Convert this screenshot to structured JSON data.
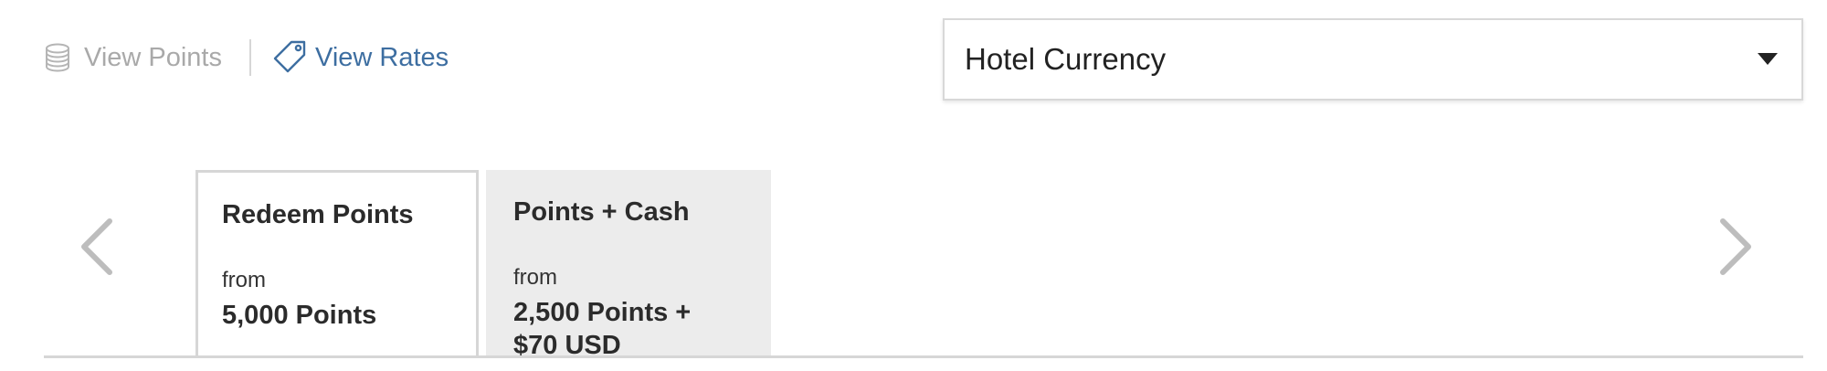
{
  "toggle": {
    "points_label": "View Points",
    "rates_label": "View Rates"
  },
  "currency": {
    "selected": "Hotel Currency"
  },
  "rate_tabs": [
    {
      "title": "Redeem Points",
      "from_label": "from",
      "price": "5,000 Points",
      "selected": true
    },
    {
      "title": "Points + Cash",
      "from_label": "from",
      "price": "2,500 Points + $70 USD",
      "selected": false
    }
  ],
  "colors": {
    "link_active": "#3d6ea1",
    "link_inactive": "#a9a9a9",
    "tab_inactive_bg": "#ececec",
    "border": "#d6d6d6"
  },
  "icons": [
    "coins-stack-icon",
    "price-tag-icon",
    "chevron-down-icon",
    "chevron-left-icon",
    "chevron-right-icon"
  ]
}
